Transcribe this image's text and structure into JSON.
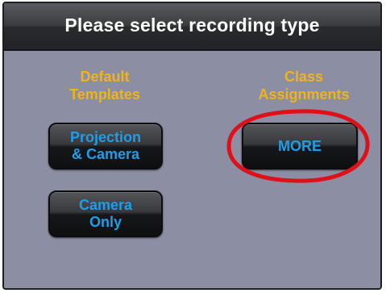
{
  "header": {
    "title": "Please select recording type"
  },
  "left_column": {
    "heading": "Default\nTemplates",
    "buttons": [
      {
        "label": "Projection\n& Camera"
      },
      {
        "label": "Camera\nOnly"
      }
    ]
  },
  "right_column": {
    "heading": "Class\nAssignments",
    "buttons": [
      {
        "label": "MORE"
      }
    ]
  },
  "colors": {
    "panel_background": "#8c8fa3",
    "heading_text": "#f0b418",
    "button_text": "#1e9ee8",
    "annotation": "#e0101a"
  }
}
